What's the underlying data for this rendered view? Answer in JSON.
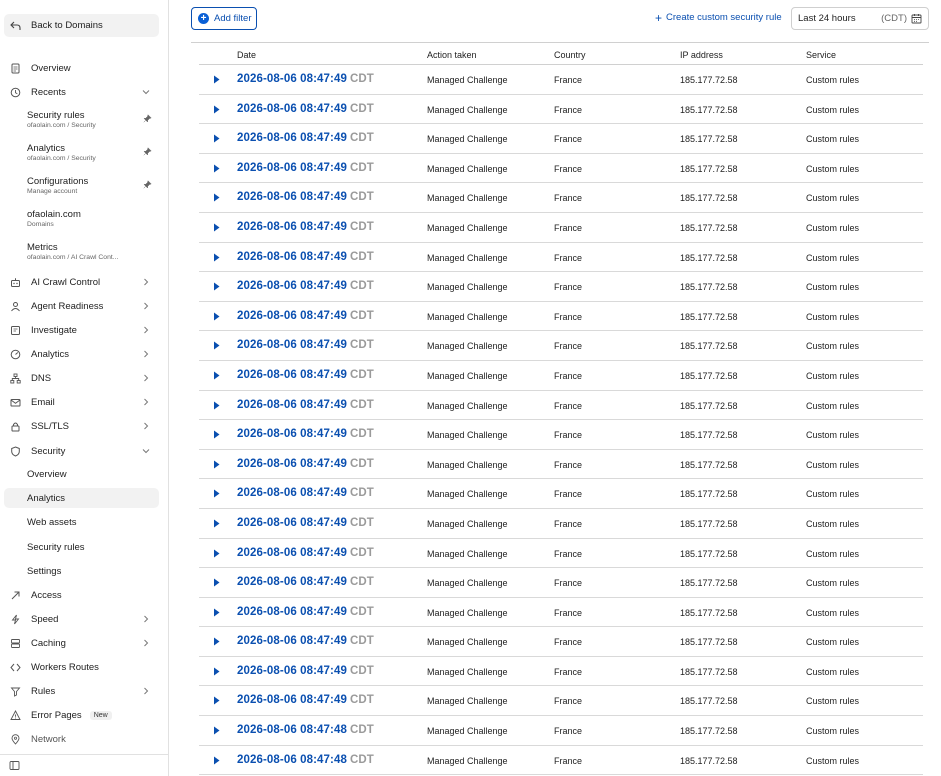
{
  "sidebar": {
    "back_label": "Back to Domains",
    "overview": "Overview",
    "recents": "Recents",
    "recent_items": [
      {
        "title": "Security rules",
        "sub": "ofaolain.com  /  Security",
        "pinned": true
      },
      {
        "title": "Analytics",
        "sub": "ofaolain.com  /  Security",
        "pinned": true
      },
      {
        "title": "Configurations",
        "sub": "Manage account",
        "pinned": true
      },
      {
        "title": "ofaolain.com",
        "sub": "Domains",
        "pinned": false
      },
      {
        "title": "Metrics",
        "sub": "ofaolain.com  /  AI Crawl Cont...",
        "pinned": false
      }
    ],
    "ai_crawl_control": "AI Crawl Control",
    "agent_readiness": "Agent Readiness",
    "investigate": "Investigate",
    "analytics": "Analytics",
    "dns": "DNS",
    "email": "Email",
    "ssl_tls": "SSL/TLS",
    "security": "Security",
    "security_sub": [
      "Overview",
      "Analytics",
      "Web assets",
      "Security rules",
      "Settings"
    ],
    "access": "Access",
    "speed": "Speed",
    "caching": "Caching",
    "workers_routes": "Workers Routes",
    "rules": "Rules",
    "error_pages": "Error Pages",
    "new_badge": "New",
    "network": "Network"
  },
  "toolbar": {
    "add_filter": "Add filter",
    "create_rule": "Create custom security rule",
    "date_range": "Last 24 hours",
    "timezone": "(CDT)"
  },
  "table": {
    "headers": [
      "Date",
      "Action taken",
      "Country",
      "IP address",
      "Service"
    ],
    "rows": [
      {
        "date": "2026-08-06 08:47:49",
        "tz": "CDT",
        "action": "Managed Challenge",
        "country": "France",
        "ip": "185.177.72.58",
        "service": "Custom rules"
      },
      {
        "date": "2026-08-06 08:47:49",
        "tz": "CDT",
        "action": "Managed Challenge",
        "country": "France",
        "ip": "185.177.72.58",
        "service": "Custom rules"
      },
      {
        "date": "2026-08-06 08:47:49",
        "tz": "CDT",
        "action": "Managed Challenge",
        "country": "France",
        "ip": "185.177.72.58",
        "service": "Custom rules"
      },
      {
        "date": "2026-08-06 08:47:49",
        "tz": "CDT",
        "action": "Managed Challenge",
        "country": "France",
        "ip": "185.177.72.58",
        "service": "Custom rules"
      },
      {
        "date": "2026-08-06 08:47:49",
        "tz": "CDT",
        "action": "Managed Challenge",
        "country": "France",
        "ip": "185.177.72.58",
        "service": "Custom rules"
      },
      {
        "date": "2026-08-06 08:47:49",
        "tz": "CDT",
        "action": "Managed Challenge",
        "country": "France",
        "ip": "185.177.72.58",
        "service": "Custom rules"
      },
      {
        "date": "2026-08-06 08:47:49",
        "tz": "CDT",
        "action": "Managed Challenge",
        "country": "France",
        "ip": "185.177.72.58",
        "service": "Custom rules"
      },
      {
        "date": "2026-08-06 08:47:49",
        "tz": "CDT",
        "action": "Managed Challenge",
        "country": "France",
        "ip": "185.177.72.58",
        "service": "Custom rules"
      },
      {
        "date": "2026-08-06 08:47:49",
        "tz": "CDT",
        "action": "Managed Challenge",
        "country": "France",
        "ip": "185.177.72.58",
        "service": "Custom rules"
      },
      {
        "date": "2026-08-06 08:47:49",
        "tz": "CDT",
        "action": "Managed Challenge",
        "country": "France",
        "ip": "185.177.72.58",
        "service": "Custom rules"
      },
      {
        "date": "2026-08-06 08:47:49",
        "tz": "CDT",
        "action": "Managed Challenge",
        "country": "France",
        "ip": "185.177.72.58",
        "service": "Custom rules"
      },
      {
        "date": "2026-08-06 08:47:49",
        "tz": "CDT",
        "action": "Managed Challenge",
        "country": "France",
        "ip": "185.177.72.58",
        "service": "Custom rules"
      },
      {
        "date": "2026-08-06 08:47:49",
        "tz": "CDT",
        "action": "Managed Challenge",
        "country": "France",
        "ip": "185.177.72.58",
        "service": "Custom rules"
      },
      {
        "date": "2026-08-06 08:47:49",
        "tz": "CDT",
        "action": "Managed Challenge",
        "country": "France",
        "ip": "185.177.72.58",
        "service": "Custom rules"
      },
      {
        "date": "2026-08-06 08:47:49",
        "tz": "CDT",
        "action": "Managed Challenge",
        "country": "France",
        "ip": "185.177.72.58",
        "service": "Custom rules"
      },
      {
        "date": "2026-08-06 08:47:49",
        "tz": "CDT",
        "action": "Managed Challenge",
        "country": "France",
        "ip": "185.177.72.58",
        "service": "Custom rules"
      },
      {
        "date": "2026-08-06 08:47:49",
        "tz": "CDT",
        "action": "Managed Challenge",
        "country": "France",
        "ip": "185.177.72.58",
        "service": "Custom rules"
      },
      {
        "date": "2026-08-06 08:47:49",
        "tz": "CDT",
        "action": "Managed Challenge",
        "country": "France",
        "ip": "185.177.72.58",
        "service": "Custom rules"
      },
      {
        "date": "2026-08-06 08:47:49",
        "tz": "CDT",
        "action": "Managed Challenge",
        "country": "France",
        "ip": "185.177.72.58",
        "service": "Custom rules"
      },
      {
        "date": "2026-08-06 08:47:49",
        "tz": "CDT",
        "action": "Managed Challenge",
        "country": "France",
        "ip": "185.177.72.58",
        "service": "Custom rules"
      },
      {
        "date": "2026-08-06 08:47:49",
        "tz": "CDT",
        "action": "Managed Challenge",
        "country": "France",
        "ip": "185.177.72.58",
        "service": "Custom rules"
      },
      {
        "date": "2026-08-06 08:47:49",
        "tz": "CDT",
        "action": "Managed Challenge",
        "country": "France",
        "ip": "185.177.72.58",
        "service": "Custom rules"
      },
      {
        "date": "2026-08-06 08:47:48",
        "tz": "CDT",
        "action": "Managed Challenge",
        "country": "France",
        "ip": "185.177.72.58",
        "service": "Custom rules"
      },
      {
        "date": "2026-08-06 08:47:48",
        "tz": "CDT",
        "action": "Managed Challenge",
        "country": "France",
        "ip": "185.177.72.58",
        "service": "Custom rules"
      }
    ]
  }
}
